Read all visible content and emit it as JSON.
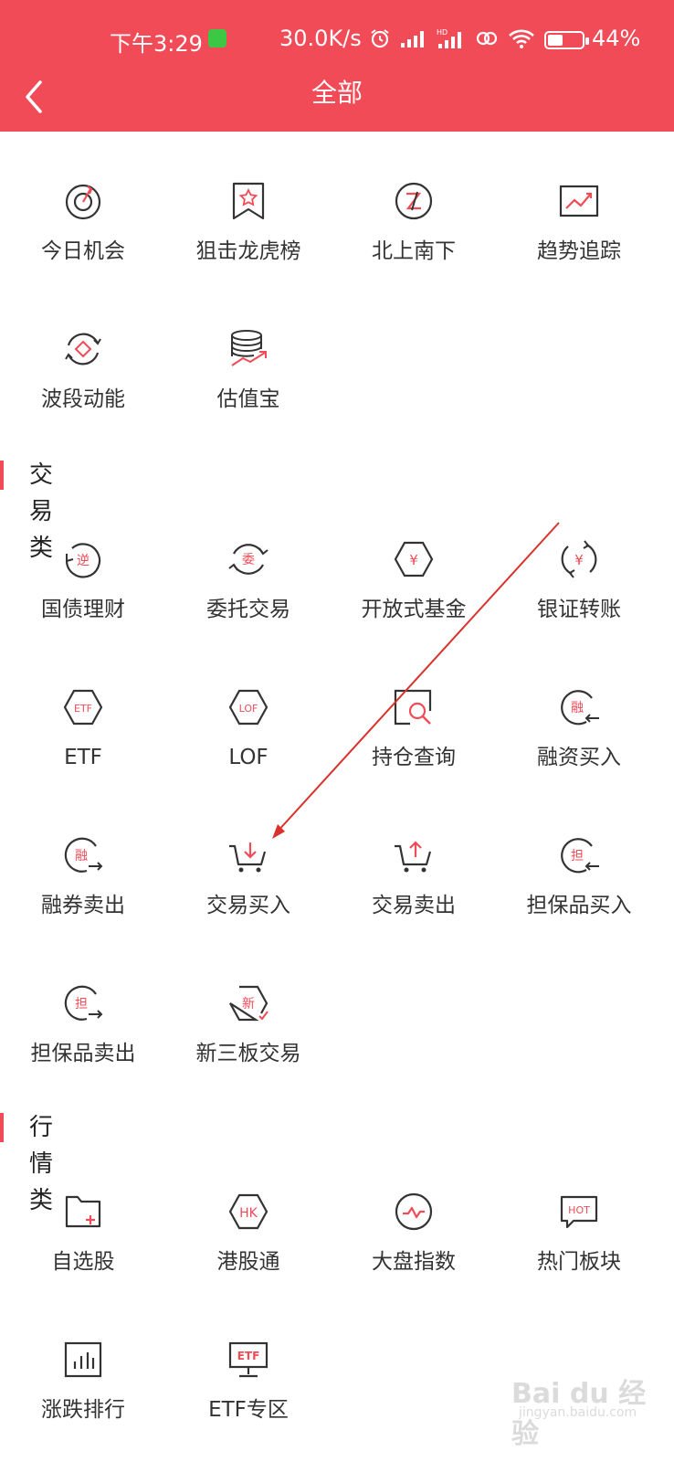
{
  "status_bar": {
    "time": "下午3:29",
    "speed": "30.0K/s",
    "battery_text": "44%",
    "battery_level": 0.44
  },
  "header": {
    "title": "全部"
  },
  "colors": {
    "accent": "#f04b57",
    "text": "#333333"
  },
  "top_items": [
    {
      "label": "今日机会",
      "icon": "target-icon"
    },
    {
      "label": "狙击龙虎榜",
      "icon": "bookmark-star-icon"
    },
    {
      "label": "北上南下",
      "icon": "north-south-icon"
    },
    {
      "label": "趋势追踪",
      "icon": "trend-chart-icon"
    },
    {
      "label": "波段动能",
      "icon": "cycle-diamond-icon"
    },
    {
      "label": "估值宝",
      "icon": "coin-stack-icon"
    }
  ],
  "sections": [
    {
      "title": "交易类",
      "items": [
        {
          "label": "国债理财",
          "icon": "bond-icon",
          "glyph": "逆"
        },
        {
          "label": "委托交易",
          "icon": "entrust-icon",
          "glyph": "委"
        },
        {
          "label": "开放式基金",
          "icon": "fund-icon",
          "glyph": "¥"
        },
        {
          "label": "银证转账",
          "icon": "transfer-icon",
          "glyph": "¥"
        },
        {
          "label": "ETF",
          "icon": "etf-icon",
          "glyph": "ETF"
        },
        {
          "label": "LOF",
          "icon": "lof-icon",
          "glyph": "LOF"
        },
        {
          "label": "持仓查询",
          "icon": "position-search-icon"
        },
        {
          "label": "融资买入",
          "icon": "margin-buy-icon",
          "glyph": "融"
        },
        {
          "label": "融券卖出",
          "icon": "short-sell-icon",
          "glyph": "融"
        },
        {
          "label": "交易买入",
          "icon": "cart-buy-icon"
        },
        {
          "label": "交易卖出",
          "icon": "cart-sell-icon"
        },
        {
          "label": "担保品买入",
          "icon": "collateral-buy-icon",
          "glyph": "担"
        },
        {
          "label": "担保品卖出",
          "icon": "collateral-sell-icon",
          "glyph": "担"
        },
        {
          "label": "新三板交易",
          "icon": "neeq-icon",
          "glyph": "新"
        }
      ]
    },
    {
      "title": "行情类",
      "items": [
        {
          "label": "自选股",
          "icon": "folder-plus-icon"
        },
        {
          "label": "港股通",
          "icon": "hk-icon",
          "glyph": "HK"
        },
        {
          "label": "大盘指数",
          "icon": "index-pulse-icon"
        },
        {
          "label": "热门板块",
          "icon": "hot-bubble-icon",
          "glyph": "HOT"
        },
        {
          "label": "涨跌排行",
          "icon": "ranking-bars-icon"
        },
        {
          "label": "ETF专区",
          "icon": "etf-monitor-icon",
          "glyph": "ETF"
        }
      ]
    }
  ],
  "watermark": {
    "main": "Bai du 经验",
    "sub": "jingyan.baidu.com"
  }
}
